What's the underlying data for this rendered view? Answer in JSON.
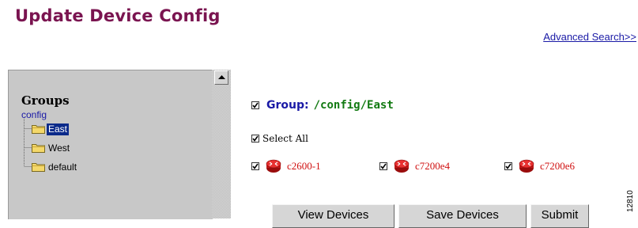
{
  "page": {
    "title": "Update Device Config",
    "advanced_search": "Advanced Search>>"
  },
  "groups_panel": {
    "heading": "Groups",
    "root": "config",
    "items": [
      {
        "label": "East",
        "selected": true
      },
      {
        "label": "West",
        "selected": false
      },
      {
        "label": "default",
        "selected": false
      }
    ]
  },
  "group_selection": {
    "checked": true,
    "prefix": "Group:",
    "path": "/config/East"
  },
  "select_all": {
    "checked": true,
    "label": "Select All"
  },
  "devices": [
    {
      "name": "c2600-1",
      "checked": true
    },
    {
      "name": "c7200e4",
      "checked": true
    },
    {
      "name": "c7200e6",
      "checked": true
    }
  ],
  "buttons": {
    "view_devices": "View Devices",
    "save_devices": "Save Devices",
    "submit": "Submit"
  },
  "side_text": "12810",
  "colors": {
    "title": "#7a1450",
    "link": "#1a1aa6",
    "group_path": "#127a12",
    "device_name": "#d01010",
    "tree_selected_bg": "#0b2a8a",
    "panel_bg": "#c8c8c8"
  },
  "icons": {
    "folder": "folder-icon",
    "router": "router-icon",
    "check": "checkmark-icon",
    "scroll_up": "scroll-up-arrow-icon"
  }
}
